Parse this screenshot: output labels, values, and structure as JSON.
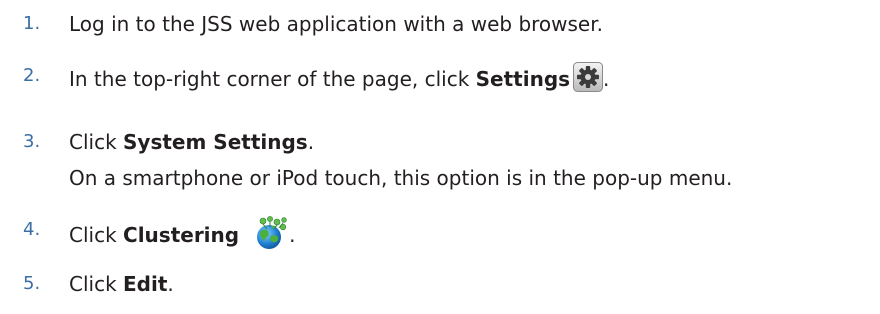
{
  "steps": [
    {
      "number": "1.",
      "text": "Log in to the JSS web application with a web browser."
    },
    {
      "number": "2.",
      "text_before": "In the top-right corner of the page, click ",
      "bold": "Settings",
      "icon": "settings-gear-icon",
      "text_after": "."
    },
    {
      "number": "3.",
      "text_before": "Click ",
      "bold": "System Settings",
      "text_after": ".",
      "note": "On a smartphone or iPod touch, this option is in the pop-up menu."
    },
    {
      "number": "4.",
      "text_before": "Click ",
      "bold": "Clustering",
      "icon": "clustering-globe-icon",
      "text_after": "."
    },
    {
      "number": "5.",
      "text_before": "Click ",
      "bold": "Edit",
      "text_after": "."
    }
  ],
  "colors": {
    "number": "#3a6ea5",
    "text": "#231f20"
  }
}
